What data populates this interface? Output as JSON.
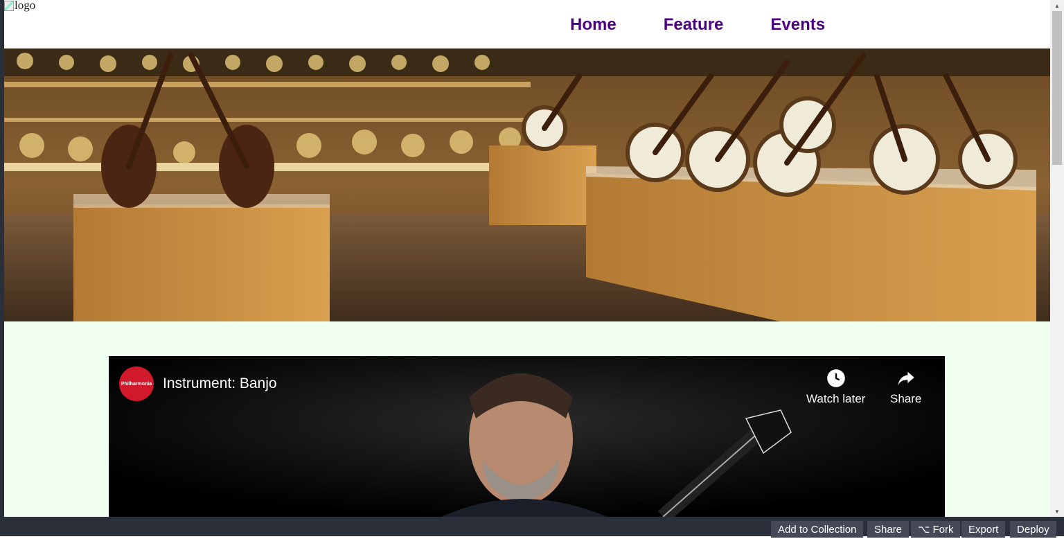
{
  "header": {
    "logo_alt": "logo",
    "nav": [
      "Home",
      "Feature",
      "Events"
    ]
  },
  "hero": {
    "image": "banjo museum display"
  },
  "video": {
    "channel": "Philharmonia",
    "title": "Instrument: Banjo",
    "watch_later": "Watch later",
    "share": "Share"
  },
  "bottombar": {
    "add_to_collection": "Add to Collection",
    "share": "Share",
    "fork": "Fork",
    "export": "Export",
    "deploy": "Deploy"
  },
  "colors": {
    "nav": "#4b0082",
    "page_bg": "#f0fff0",
    "channel_red": "#d2192b",
    "bottombar": "#2a2f3a"
  }
}
